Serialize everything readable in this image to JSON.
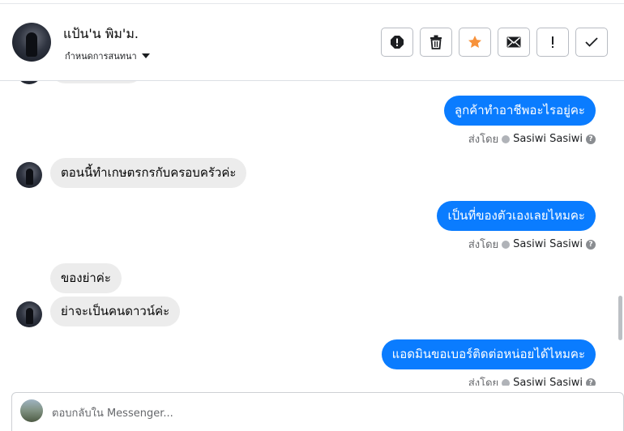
{
  "header": {
    "contact_name": "แป้น'น พิม'ม.",
    "assign_label": "กำหนดการสนทนา",
    "actions": [
      "spam-icon",
      "trash-icon",
      "star-icon",
      "mail-icon",
      "follow-up-icon",
      "done-icon"
    ]
  },
  "messages": [
    {
      "direction": "out",
      "text": "ลูกค้าทำอาชีพอะไรอยู่คะ",
      "sent_by_label": "ส่งโดย",
      "agent": "Sasiwi Sasiwi"
    },
    {
      "direction": "in",
      "text": "ตอนนี้ทำเกษตรกรกับครอบครัวค่ะ"
    },
    {
      "direction": "out",
      "text": "เป็นที่ของตัวเองเลยไหมคะ",
      "sent_by_label": "ส่งโดย",
      "agent": "Sasiwi Sasiwi"
    },
    {
      "direction": "in",
      "text": "ของย่าค่ะ"
    },
    {
      "direction": "in",
      "text": "ย่าจะเป็นคนดาวน์ค่ะ"
    },
    {
      "direction": "out",
      "text": "แอดมินขอเบอร์ติดต่อหน่อยได้ไหมคะ",
      "sent_by_label": "ส่งโดย",
      "agent": "Sasiwi Sasiwi"
    }
  ],
  "reply": {
    "placeholder": "ตอบกลับใน Messenger..."
  },
  "colors": {
    "outgoing_bubble": "#0a7cff",
    "incoming_bubble": "#ececec",
    "star": "#f7923b"
  }
}
